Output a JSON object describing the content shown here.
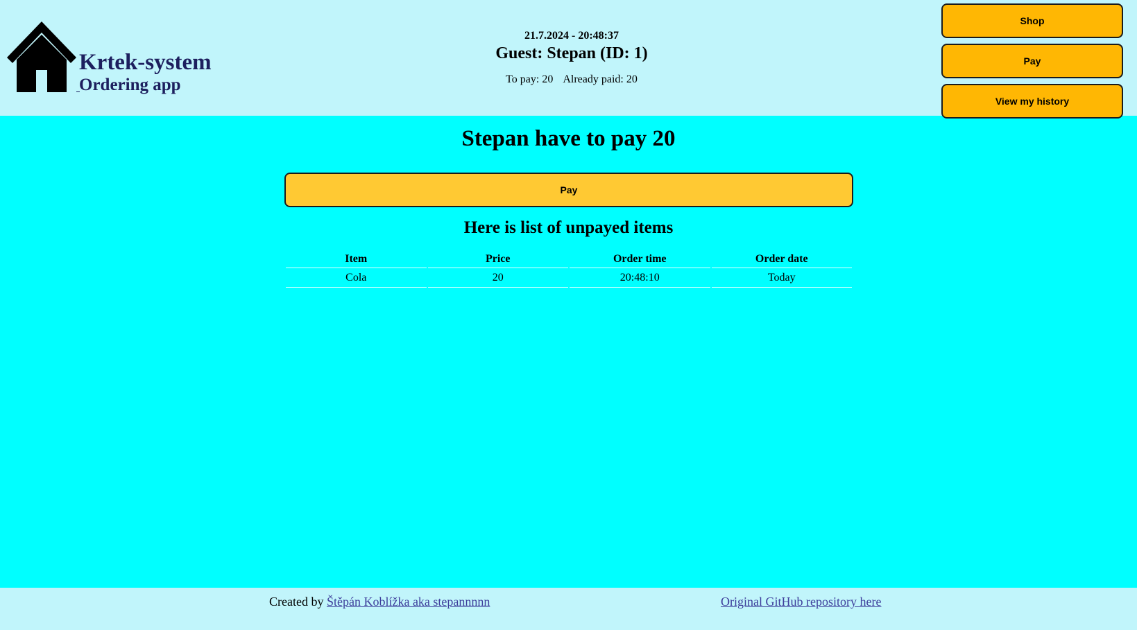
{
  "header": {
    "brand_title": "Krtek-system",
    "brand_subtitle": "Ordering app",
    "datetime": "21.7.2024 - 20:48:37",
    "guest": "Guest: Stepan (ID: 1)",
    "to_pay": "To pay: 20",
    "already_paid": "Already paid: 20",
    "nav": {
      "shop_label": "Shop",
      "pay_label": "Pay",
      "history_label": "View my history"
    },
    "colors": {
      "background": "#c1f5fb",
      "button": "#ffb703",
      "brand": "#1d1f5e"
    }
  },
  "main": {
    "title": "Stepan have to pay 20",
    "pay_button_label": "Pay",
    "list_title": "Here is list of unpayed items",
    "table": {
      "headers": [
        "Item",
        "Price",
        "Order time",
        "Order date"
      ],
      "rows": [
        [
          "Cola",
          "20",
          "20:48:10",
          "Today"
        ]
      ]
    },
    "colors": {
      "background": "#00ffff",
      "pay_button": "#ffc933"
    }
  },
  "footer": {
    "created_by": "Created by ",
    "author_link": "Štěpán Koblížka aka stepannnnn ",
    "repo_link": "Original GitHub repository here"
  },
  "icons": {
    "logo": "home-icon"
  }
}
